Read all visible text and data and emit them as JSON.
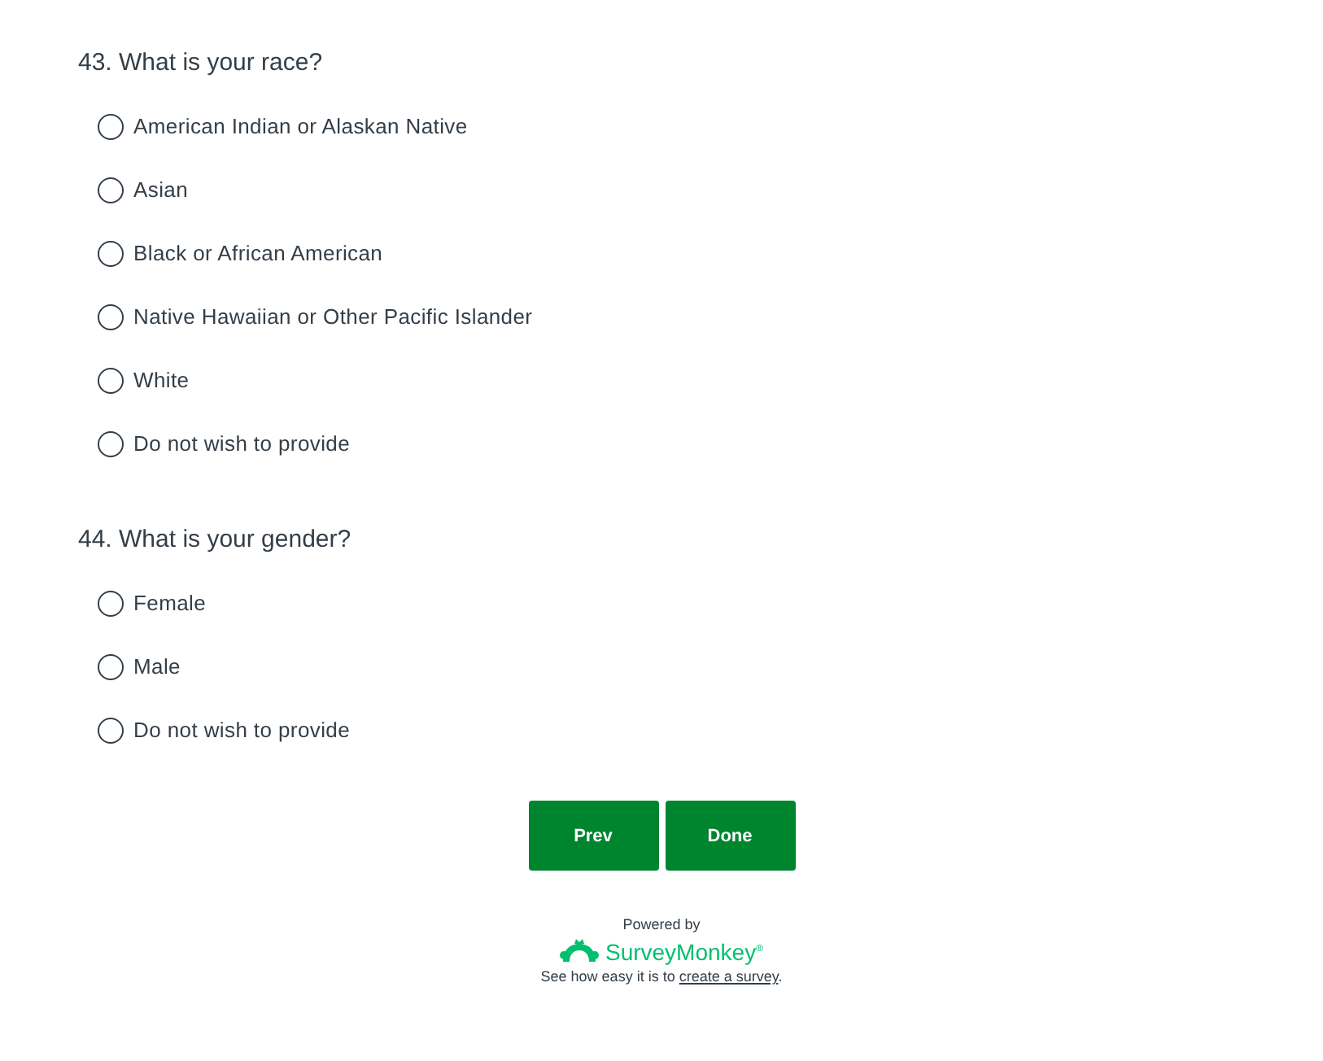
{
  "questions": [
    {
      "title": "43. What is your race?",
      "options": [
        {
          "label": "American Indian or Alaskan Native",
          "selected": false
        },
        {
          "label": "Asian",
          "selected": false
        },
        {
          "label": "Black or African American",
          "selected": false
        },
        {
          "label": "Native Hawaiian or Other Pacific Islander",
          "selected": false
        },
        {
          "label": "White",
          "selected": false
        },
        {
          "label": "Do not wish to provide",
          "selected": false
        }
      ]
    },
    {
      "title": "44. What is your gender?",
      "options": [
        {
          "label": "Female",
          "selected": false
        },
        {
          "label": "Male",
          "selected": false
        },
        {
          "label": "Do not wish to provide",
          "selected": false
        }
      ]
    }
  ],
  "buttons": [
    "Prev",
    "Done"
  ],
  "footer": {
    "powered": "Powered by",
    "brand": "SurveyMonkey$^{®}$",
    "before": "See how easy it is to ",
    "link": "create a survey",
    "after": "."
  }
}
